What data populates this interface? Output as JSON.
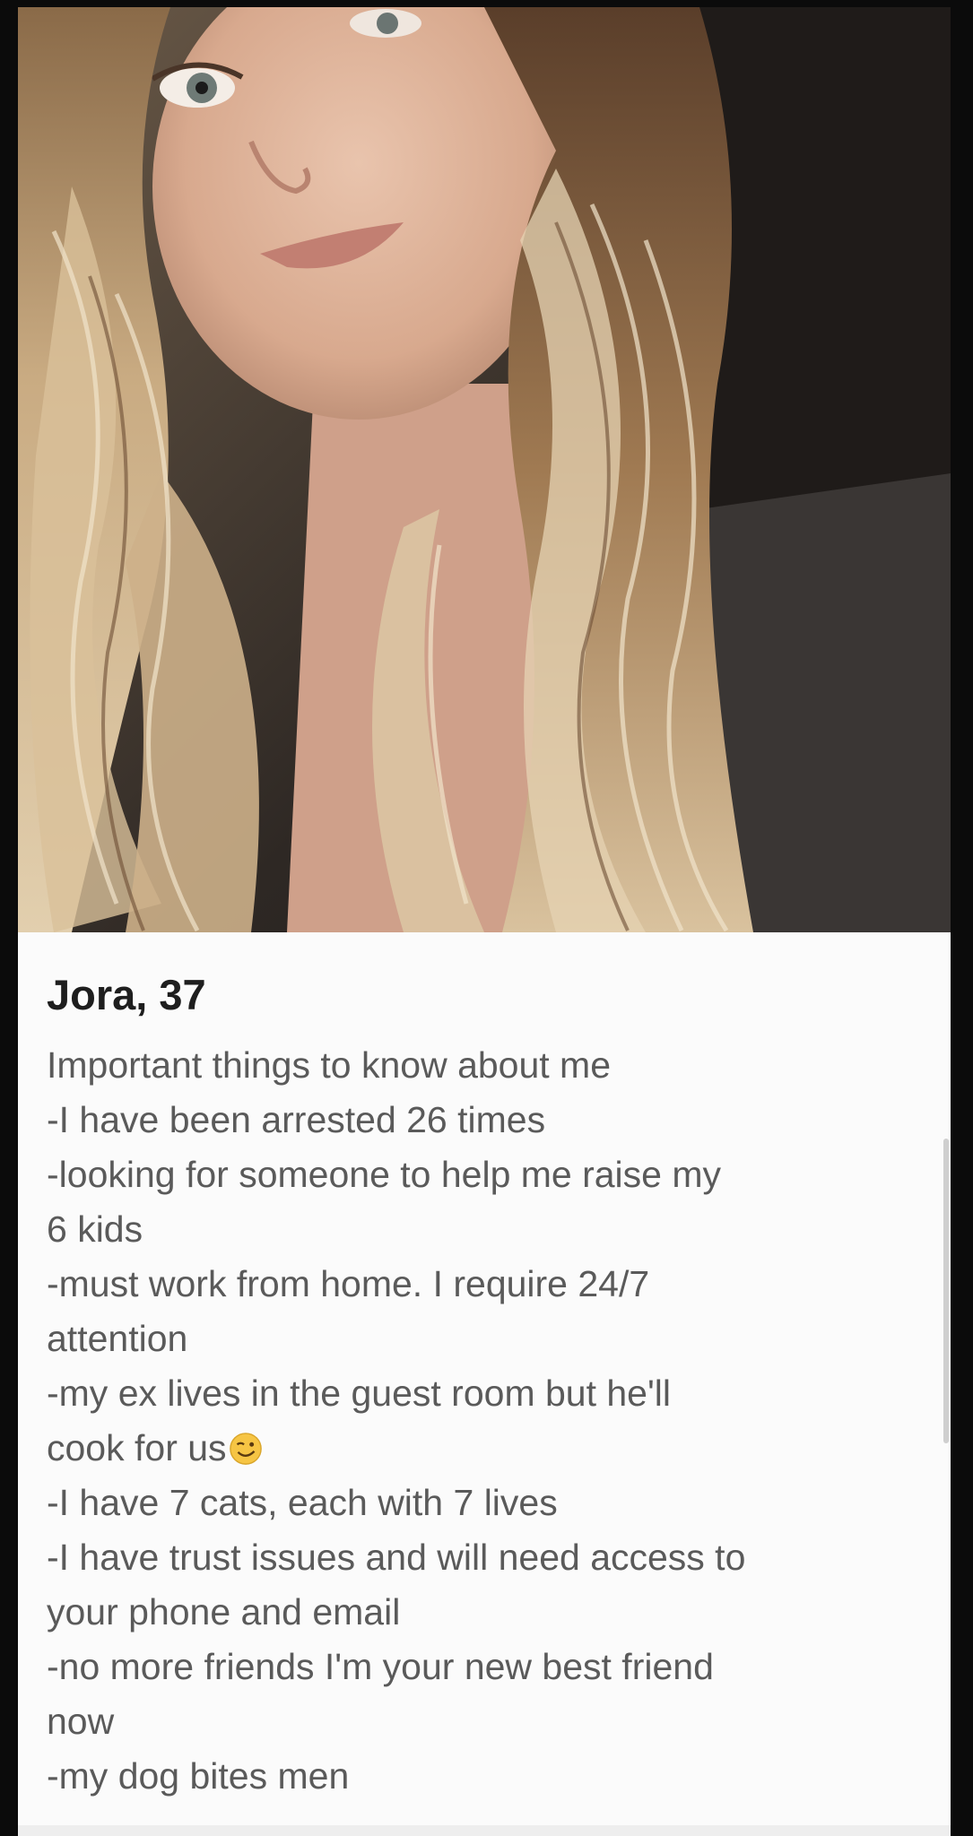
{
  "profile": {
    "photo_icon": "profile-photo",
    "name_age": "Jora, 37",
    "bio_lines": [
      "Important things to know about me",
      "-I have been arrested 26 times",
      "-looking for someone to help me raise my",
      "6 kids",
      "-must work from home. I require 24/7",
      "attention",
      "-my ex lives in the guest room but he'll",
      "cook for us",
      "-I have 7 cats, each with 7 lives",
      "-I have trust issues and will need access to",
      "your phone and email",
      "-no more friends I'm your new best friend",
      "now",
      "-my dog bites men"
    ],
    "emoji_icon": "winking-face-icon"
  },
  "colors": {
    "background": "#0b0b0b",
    "card": "#fbfbfb",
    "name_text": "#1e1e1e",
    "bio_text": "#5a5a5a"
  }
}
